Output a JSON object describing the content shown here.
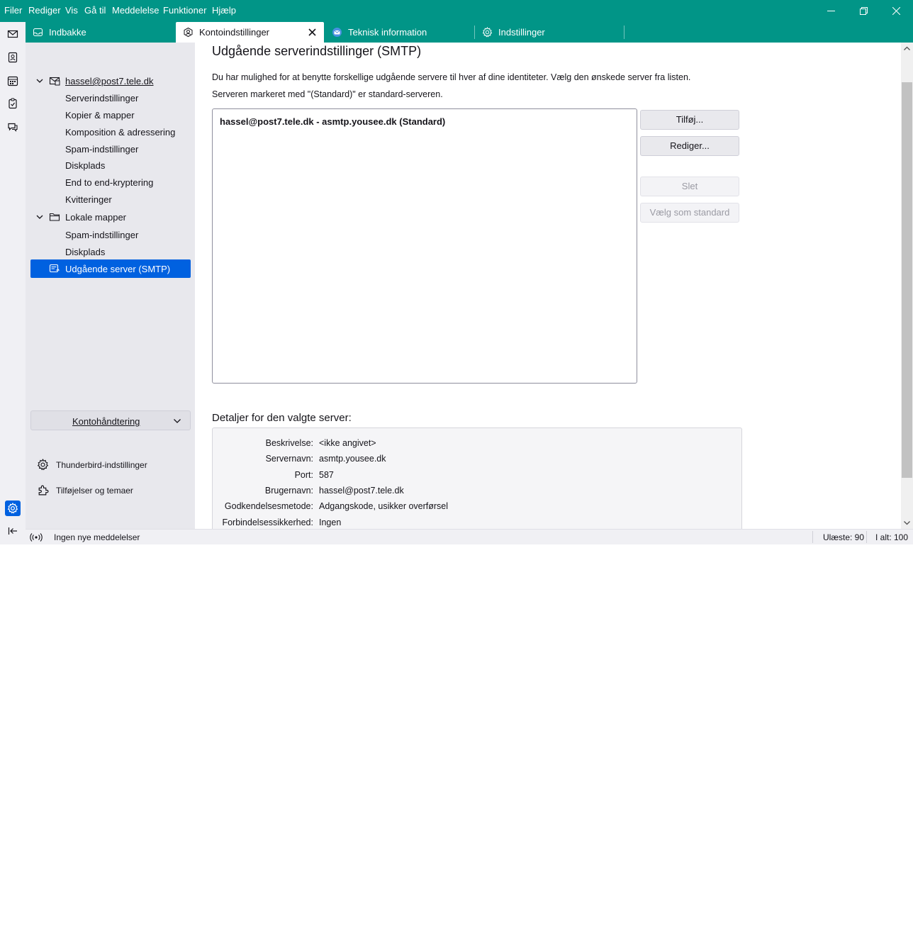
{
  "menu": [
    "Filer",
    "Rediger",
    "Vis",
    "Gå til",
    "Meddelelse",
    "Funktioner",
    "Hjælp"
  ],
  "tabs": [
    {
      "label": "Indbakke",
      "icon": "inbox-icon"
    },
    {
      "label": "Kontoindstillinger",
      "icon": "account-settings-icon",
      "selected": true
    },
    {
      "label": "Teknisk information",
      "icon": "thunderbird-logo-icon"
    },
    {
      "label": "Indstillinger",
      "icon": "gear-icon"
    }
  ],
  "spaces": [
    "mail-icon",
    "address-book-icon",
    "calendar-icon",
    "tasks-icon",
    "chat-icon"
  ],
  "tree": {
    "account": "hassel@post7.tele.dk",
    "account_items": [
      "Serverindstillinger",
      "Kopier & mapper",
      "Komposition & adressering",
      "Spam-indstillinger",
      "Diskplads",
      "End to end-kryptering",
      "Kvitteringer"
    ],
    "local": "Lokale mapper",
    "local_items": [
      "Spam-indstillinger",
      "Diskplads"
    ],
    "smtp": "Udgående server (SMTP)",
    "account_actions": "Kontohåndtering",
    "tb_settings": "Thunderbird-indstillinger",
    "addons": "Tilføjelser og temaer"
  },
  "content": {
    "title": "Udgående serverindstillinger (SMTP)",
    "desc1": "Du har mulighed for at benytte forskellige udgående servere til hver af dine identiteter. Vælg den ønskede server fra listen.",
    "desc2": "Serveren markeret med \"(Standard)\" er standard-serveren.",
    "servers": [
      "hassel@post7.tele.dk - asmtp.yousee.dk (Standard)"
    ],
    "buttons": {
      "add": "Tilføj...",
      "edit": "Rediger...",
      "delete": "Slet",
      "set_default": "Vælg som standard"
    },
    "details_title": "Detaljer for den valgte server:",
    "details": [
      {
        "key": "Beskrivelse:",
        "value": "<ikke angivet>"
      },
      {
        "key": "Servernavn:",
        "value": "asmtp.yousee.dk"
      },
      {
        "key": "Port:",
        "value": "587"
      },
      {
        "key": "Brugernavn:",
        "value": "hassel@post7.tele.dk"
      },
      {
        "key": "Godkendelsesmetode:",
        "value": "Adgangskode, usikker overførsel"
      },
      {
        "key": "Forbindelsessikkerhed:",
        "value": "Ingen"
      }
    ]
  },
  "status": {
    "text": "Ingen nye meddelelser",
    "unread": "Ulæste: 90",
    "total": "I alt: 100"
  },
  "colors": {
    "accent": "#019587",
    "selection": "#0061e0"
  }
}
